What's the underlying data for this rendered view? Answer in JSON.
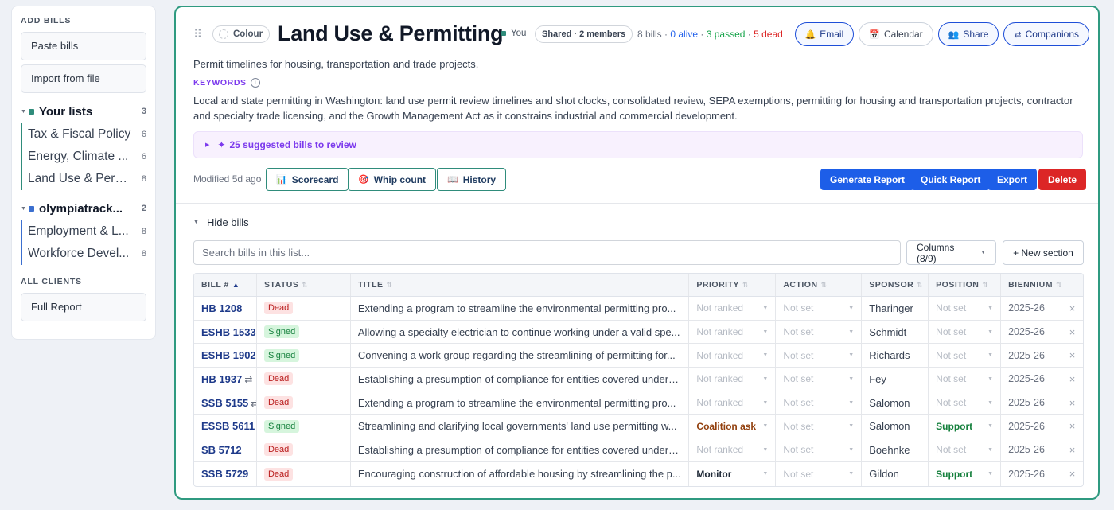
{
  "sidebar": {
    "add_bills_heading": "ADD BILLS",
    "paste_bills": "Paste bills",
    "import_file": "Import from file",
    "groups": [
      {
        "title": "Your lists",
        "count": "3",
        "color": "#2f8c7b",
        "items": [
          {
            "label": "Tax & Fiscal Policy",
            "count": "6"
          },
          {
            "label": "Energy, Climate ...",
            "count": "6"
          },
          {
            "label": "Land Use & Perm...",
            "count": "8"
          }
        ]
      },
      {
        "title": "olympiatrack...",
        "count": "2",
        "color": "#3b6fcf",
        "items": [
          {
            "label": "Employment & L...",
            "count": "8"
          },
          {
            "label": "Workforce Devel...",
            "count": "8"
          }
        ]
      }
    ],
    "all_clients_heading": "ALL CLIENTS",
    "full_report": "Full Report"
  },
  "header": {
    "colour_label": "Colour",
    "title": "Land Use & Permitting",
    "you_label": "You",
    "shared_label": "Shared · 2 members",
    "stats": {
      "bills": "8 bills",
      "sep1": " · ",
      "alive": "0 alive",
      "sep2": " · ",
      "passed": "3 passed",
      "sep3": " · ",
      "dead": "5 dead"
    },
    "buttons": {
      "email": "Email",
      "calendar": "Calendar",
      "share": "Share",
      "companions": "Companions"
    }
  },
  "description": "Permit timelines for housing, transportation and trade projects.",
  "keywords": {
    "label": "KEYWORDS",
    "text": "Local and state permitting in Washington: land use permit review timelines and shot clocks, consolidated review, SEPA exemptions, permitting for housing and transportation projects, contractor and specialty trade licensing, and the Growth Management Act as it constrains industrial and commercial development."
  },
  "suggested": "25 suggested bills to review",
  "toolbar": {
    "modified": "Modified 5d ago",
    "scorecard": "Scorecard",
    "whip_count": "Whip count",
    "history": "History",
    "generate_report": "Generate Report",
    "quick_report": "Quick Report",
    "export": "Export",
    "delete": "Delete"
  },
  "bills_section": {
    "hide_label": "Hide bills",
    "search_placeholder": "Search bills in this list...",
    "columns_label": "Columns (8/9)",
    "new_section": "+ New section"
  },
  "table": {
    "headers": {
      "bill": "BILL #",
      "status": "STATUS",
      "title": "TITLE",
      "priority": "PRIORITY",
      "action": "ACTION",
      "sponsor": "SPONSOR",
      "position": "POSITION",
      "biennium": "BIENNIUM"
    },
    "rows": [
      {
        "bill": "HB 1208",
        "swap": "",
        "status": "Dead",
        "title": "Extending a program to streamline the environmental permitting pro...",
        "priority": "Not ranked",
        "action": "Not set",
        "sponsor": "Tharinger",
        "position": "Not set",
        "biennium": "2025-26"
      },
      {
        "bill": "ESHB 1533",
        "swap": "",
        "status": "Signed",
        "title": "Allowing a specialty electrician to continue working under a valid spe...",
        "priority": "Not ranked",
        "action": "Not set",
        "sponsor": "Schmidt",
        "position": "Not set",
        "biennium": "2025-26"
      },
      {
        "bill": "ESHB 1902",
        "swap": "",
        "status": "Signed",
        "title": "Convening a work group regarding the streamlining of permitting for...",
        "priority": "Not ranked",
        "action": "Not set",
        "sponsor": "Richards",
        "position": "Not set",
        "biennium": "2025-26"
      },
      {
        "bill": "HB 1937",
        "swap": "⇄",
        "status": "Dead",
        "title": "Establishing a presumption of compliance for entities covered under t...",
        "priority": "Not ranked",
        "action": "Not set",
        "sponsor": "Fey",
        "position": "Not set",
        "biennium": "2025-26"
      },
      {
        "bill": "SSB 5155",
        "swap": "⇄",
        "status": "Dead",
        "title": "Extending a program to streamline the environmental permitting pro...",
        "priority": "Not ranked",
        "action": "Not set",
        "sponsor": "Salomon",
        "position": "Not set",
        "biennium": "2025-26"
      },
      {
        "bill": "ESSB 5611",
        "swap": "",
        "status": "Signed",
        "title": "Streamlining and clarifying local governments' land use permitting w...",
        "priority": "Coalition ask",
        "action": "Not set",
        "sponsor": "Salomon",
        "position": "Support",
        "biennium": "2025-26"
      },
      {
        "bill": "SB 5712",
        "swap": "",
        "status": "Dead",
        "title": "Establishing a presumption of compliance for entities covered under t...",
        "priority": "Not ranked",
        "action": "Not set",
        "sponsor": "Boehnke",
        "position": "Not set",
        "biennium": "2025-26"
      },
      {
        "bill": "SSB 5729",
        "swap": "",
        "status": "Dead",
        "title": "Encouraging construction of affordable housing by streamlining the p...",
        "priority": "Monitor",
        "action": "Not set",
        "sponsor": "Gildon",
        "position": "Support",
        "biennium": "2025-26"
      }
    ]
  },
  "colors": {
    "accent_teal": "#2f9a80",
    "primary_blue": "#1d5ee8",
    "danger_red": "#dc2626"
  }
}
